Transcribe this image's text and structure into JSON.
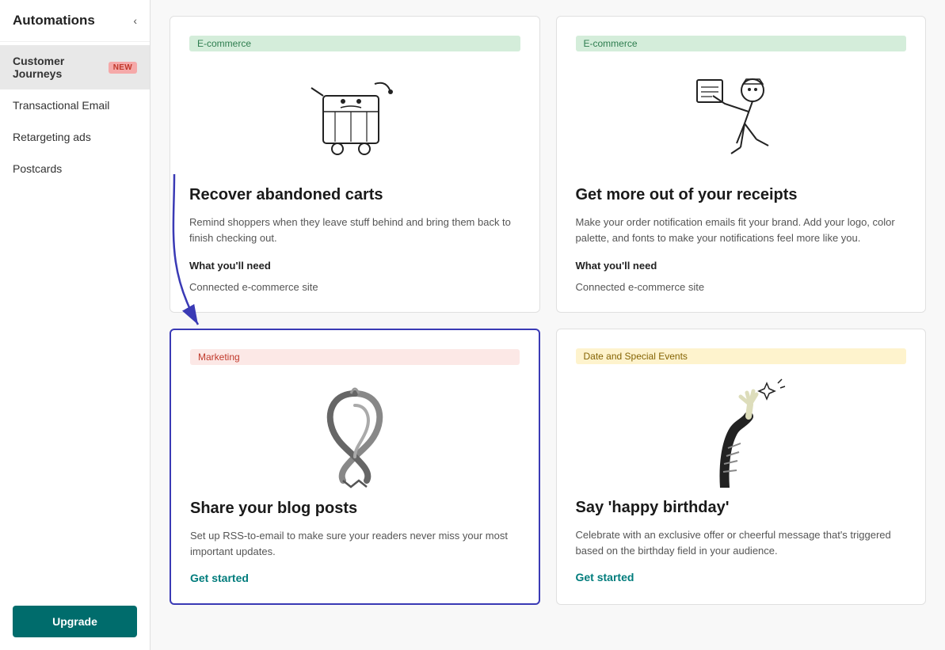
{
  "sidebar": {
    "title": "Automations",
    "collapse_icon": "‹",
    "items": [
      {
        "label": "Customer Journeys",
        "badge": "New",
        "active": true,
        "id": "customer-journeys"
      },
      {
        "label": "Transactional Email",
        "badge": null,
        "active": false,
        "id": "transactional-email"
      },
      {
        "label": "Retargeting ads",
        "badge": null,
        "active": false,
        "id": "retargeting-ads"
      },
      {
        "label": "Postcards",
        "badge": null,
        "active": false,
        "id": "postcards"
      }
    ],
    "upgrade_label": "Upgrade"
  },
  "cards": [
    {
      "id": "recover-carts",
      "badge_label": "E-commerce",
      "badge_type": "ecommerce",
      "title": "Recover abandoned carts",
      "description": "Remind shoppers when they leave stuff behind and bring them back to finish checking out.",
      "requirement_label": "What you'll need",
      "requirement_value": "Connected e-commerce site",
      "has_cta": false,
      "highlighted": false
    },
    {
      "id": "receipts",
      "badge_label": "E-commerce",
      "badge_type": "ecommerce",
      "title": "Get more out of your receipts",
      "description": "Make your order notification emails fit your brand. Add your logo, color palette, and fonts to make your notifications feel more like you.",
      "requirement_label": "What you'll need",
      "requirement_value": "Connected e-commerce site",
      "has_cta": false,
      "highlighted": false
    },
    {
      "id": "blog-posts",
      "badge_label": "Marketing",
      "badge_type": "marketing",
      "title": "Share your blog posts",
      "description": "Set up RSS-to-email to make sure your readers never miss your most important updates.",
      "requirement_label": null,
      "requirement_value": null,
      "has_cta": true,
      "cta_label": "Get started",
      "highlighted": true
    },
    {
      "id": "birthday",
      "badge_label": "Date and Special Events",
      "badge_type": "date",
      "title": "Say 'happy birthday'",
      "description": "Celebrate with an exclusive offer or cheerful message that's triggered based on the birthday field in your audience.",
      "requirement_label": null,
      "requirement_value": null,
      "has_cta": true,
      "cta_label": "Get started",
      "highlighted": false
    }
  ]
}
